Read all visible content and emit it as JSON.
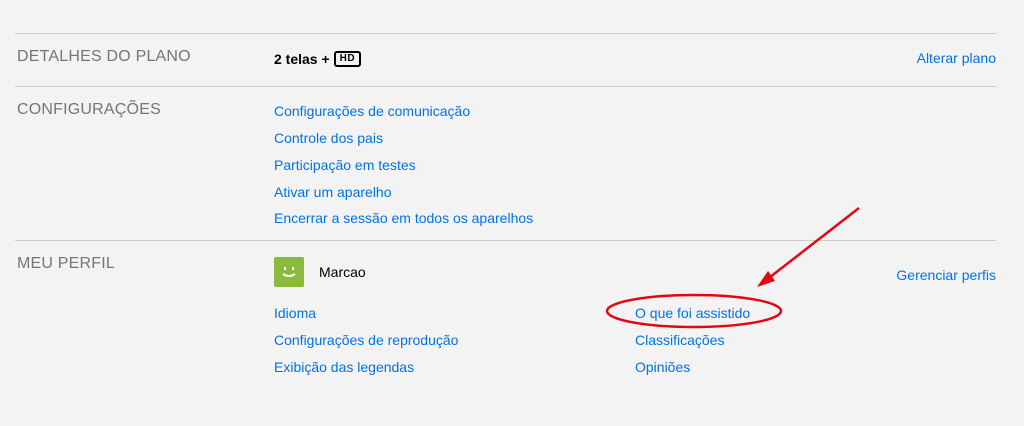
{
  "plan": {
    "title": "DETALHES DO PLANO",
    "value": "2 telas +",
    "badge": "HD",
    "action": "Alterar plano"
  },
  "settings": {
    "title": "CONFIGURAÇÕES",
    "links": [
      "Configurações de comunicação",
      "Controle dos pais",
      "Participação em testes",
      "Ativar um aparelho",
      "Encerrar a sessão em todos os aparelhos"
    ]
  },
  "profile": {
    "title": "MEU PERFIL",
    "name": "Marcao",
    "action": "Gerenciar perfis",
    "links_left": [
      "Idioma",
      "Configurações de reprodução",
      "Exibição das legendas"
    ],
    "links_right": [
      "O que foi assistido",
      "Classificações",
      "Opiniões"
    ]
  },
  "colors": {
    "link": "#0073e6",
    "annotation": "#e30613",
    "avatar": "#8cba3c"
  },
  "icons": {
    "avatar": "smiley-face-icon",
    "annotation": "red-arrow-icon"
  }
}
